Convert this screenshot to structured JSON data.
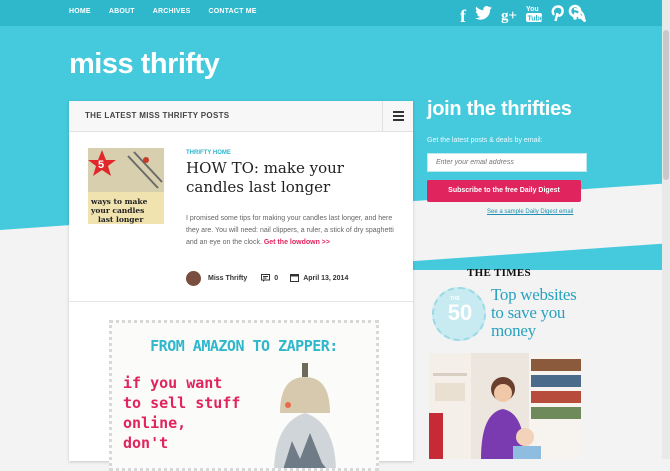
{
  "nav": {
    "items": [
      "HOME",
      "ABOUT",
      "ARCHIVES",
      "CONTACT ME"
    ]
  },
  "social": {
    "icons": [
      "facebook-icon",
      "twitter-icon",
      "google-plus-icon",
      "youtube-icon",
      "pinterest-icon",
      "rss-icon",
      "search-icon"
    ],
    "labels": {
      "facebook": "f",
      "google": "g+"
    }
  },
  "site": {
    "title": "miss thrifty"
  },
  "posts": {
    "header": "THE LATEST MISS THRIFTY POSTS",
    "featured": {
      "thumb_number": "5",
      "thumb_text": "ways to make your candles last longer",
      "category": "THRIFTY HOME",
      "title": "HOW TO: make your candles last longer",
      "excerpt": "I promised some tips for making your candles last longer, and here they are. You will need: nail clippers, a ruler, a stick of dry spaghetti and an eye on the clock.",
      "read_more": "Get the lowdown >>",
      "author": "Miss Thrifty",
      "comments": "0",
      "date": "April 13, 2014"
    },
    "promo": {
      "heading": "FROM AMAZON TO ZAPPER:",
      "body": "if you want\nto sell stuff\nonline,\ndon't"
    }
  },
  "sidebar": {
    "join_title": "join the thrifties",
    "join_sub": "Get the latest posts & deals by email:",
    "email_placeholder": "Enter your email address",
    "subscribe_label": "Subscribe to the free Daily Digest",
    "sample_link": "See a sample Daily Digest email",
    "times_logo": "THE TIMES",
    "badge_the": "THE",
    "badge_number": "50",
    "ad_text": "Top websites to save you money"
  },
  "colors": {
    "accent": "#45c9dc",
    "topbar": "#2fb7cc",
    "pink": "#e0245e"
  }
}
